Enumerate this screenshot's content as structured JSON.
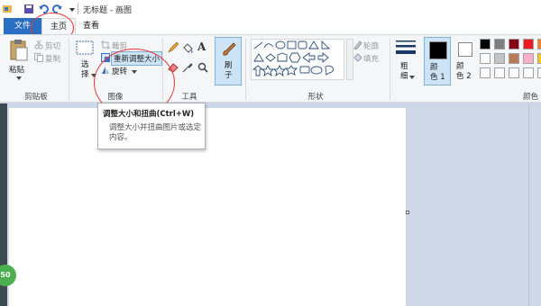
{
  "title": "无标题 - 画图",
  "tabs": {
    "file": "文件",
    "home": "主页",
    "view": "查看"
  },
  "clipboard": {
    "paste": "粘贴",
    "cut": "剪切",
    "copy": "复制",
    "group": "剪贴板"
  },
  "image": {
    "select": "选\n择",
    "crop": "裁剪",
    "resize": "重新调整大小",
    "rotate": "旋转",
    "group": "图像"
  },
  "tools": {
    "group": "工具"
  },
  "brushes": {
    "label": "刷\n子"
  },
  "shapes": {
    "outline": "轮廓",
    "fill": "填充",
    "group": "形状"
  },
  "size": {
    "label": "粗\n细"
  },
  "colors": {
    "color1": "颜\n色 1",
    "color2": "颜\n色 2",
    "group": "颜色",
    "palette": [
      "#000000",
      "#7f7f7f",
      "#880015",
      "#ed1c24",
      "#ff7f27",
      "#ffffff",
      "#c3c3c3",
      "#b97a57",
      "#ffaec9",
      "#ffc90e",
      "#ffffff",
      "#ffffff",
      "#ffffff",
      "#ffffff",
      "#ffffff"
    ]
  },
  "tooltip": {
    "title": "调整大小和扭曲(Ctrl+W)",
    "body": "调整大小并扭曲图片或选定内容。"
  },
  "bubble": "50"
}
